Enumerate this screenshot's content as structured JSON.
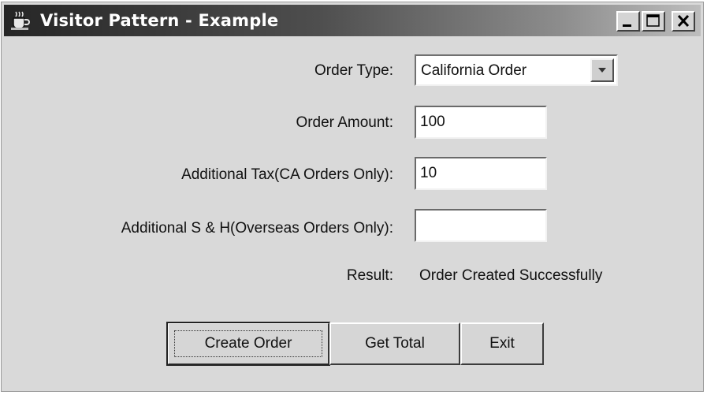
{
  "window": {
    "title": "Visitor Pattern - Example",
    "icon": "coffee-cup-icon",
    "controls": [
      "minimize-icon",
      "maximize-icon",
      "close-icon"
    ]
  },
  "form": {
    "order_type_label": "Order Type:",
    "order_type_value": "California Order",
    "order_amount_label": "Order Amount:",
    "order_amount_value": "100",
    "additional_tax_label": "Additional Tax(CA Orders Only):",
    "additional_tax_value": "10",
    "additional_sh_label": "Additional S & H(Overseas Orders Only):",
    "additional_sh_value": "",
    "result_label": "Result:",
    "result_value": "Order Created Successfully"
  },
  "buttons": {
    "create_order": "Create Order",
    "get_total": "Get Total",
    "exit": "Exit"
  }
}
